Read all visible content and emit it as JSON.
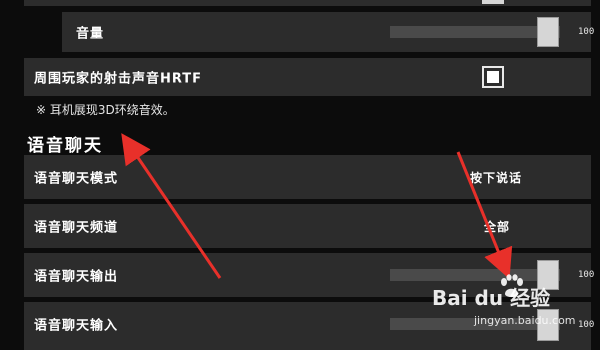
{
  "top_partial_row": {},
  "volume_row": {
    "label": "音量",
    "value": "100",
    "level_percent": 100
  },
  "hrtf_row": {
    "label": "周围玩家的射击声音HRTF",
    "checked": true
  },
  "hrtf_note": "※ 耳机展现3D环绕音效。",
  "voice_section": {
    "title": "语音聊天",
    "mode": {
      "label": "语音聊天模式",
      "value": "按下说话"
    },
    "channel": {
      "label": "语音聊天频道",
      "value": "全部"
    },
    "output": {
      "label": "语音聊天输出",
      "value": "100",
      "level_percent": 100
    },
    "input": {
      "label": "语音聊天输入",
      "value": "100",
      "level_percent": 100
    }
  },
  "watermark": {
    "logo": "Bai du 经验",
    "url": "jingyan.baidu.com"
  },
  "colors": {
    "row_bg": "#2c2c2c",
    "page_bg": "#0c0c0c",
    "annotation_arrow": "#e8302a"
  }
}
